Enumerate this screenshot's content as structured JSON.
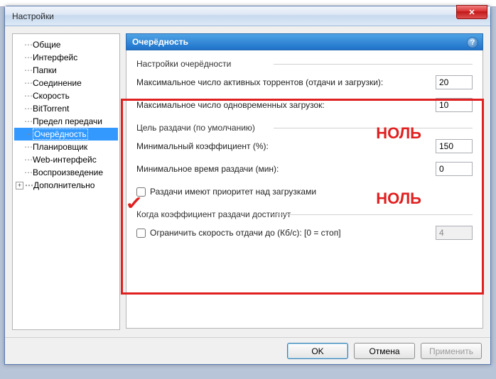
{
  "window": {
    "title": "Настройки"
  },
  "tree": {
    "items": [
      {
        "label": "Общие"
      },
      {
        "label": "Интерфейс"
      },
      {
        "label": "Папки"
      },
      {
        "label": "Соединение"
      },
      {
        "label": "Скорость"
      },
      {
        "label": "BitTorrent"
      },
      {
        "label": "Предел передачи"
      },
      {
        "label": "Очерёдность",
        "selected": true
      },
      {
        "label": "Планировщик"
      },
      {
        "label": "Web-интерфейс"
      },
      {
        "label": "Воспроизведение"
      }
    ],
    "expandable": {
      "label": "Дополнительно",
      "symbol": "+"
    }
  },
  "panel": {
    "title": "Очерёдность",
    "help_symbol": "?",
    "group1": {
      "label": "Настройки очерёдности",
      "max_active_label": "Максимальное число активных торрентов (отдачи и загрузки):",
      "max_active_value": "20",
      "max_downloads_label": "Максимальное число одновременных загрузок:",
      "max_downloads_value": "10"
    },
    "group2": {
      "label": "Цель раздачи (по умолчанию)",
      "min_ratio_label": "Минимальный коэффициент (%):",
      "min_ratio_value": "150",
      "min_time_label": "Минимальное время раздачи (мин):",
      "min_time_value": "0",
      "priority_checkbox_label": "Раздачи имеют приоритет над загрузками"
    },
    "group3": {
      "label": "Когда коэффициент раздачи достигнут",
      "limit_checkbox_label": "Ограничить скорость отдачи до (Кб/с): [0 = стоп]",
      "limit_value": "4"
    },
    "annotations": {
      "text1": "НОЛЬ",
      "text2": "НОЛЬ",
      "check": "✓"
    }
  },
  "buttons": {
    "ok": "OK",
    "cancel": "Отмена",
    "apply": "Применить"
  }
}
